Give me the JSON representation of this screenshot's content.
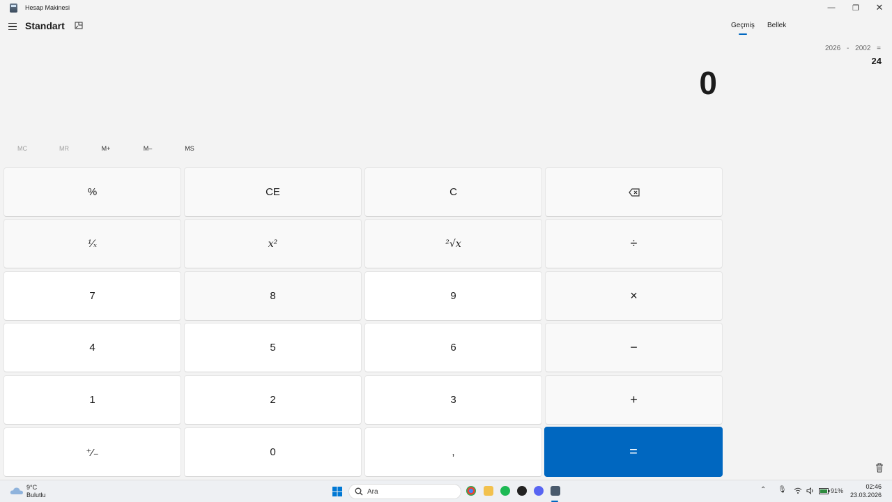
{
  "window": {
    "title": "Hesap Makinesi",
    "minimize": "—",
    "maximize": "❐",
    "close": "✕"
  },
  "header": {
    "mode_title": "Standart",
    "menu_icon": "hamburger-menu-icon",
    "keep_on_top_icon": "keep-on-top-icon"
  },
  "side_panel": {
    "tabs": [
      {
        "label": "Geçmiş",
        "active": true
      },
      {
        "label": "Bellek",
        "active": false
      }
    ],
    "history": {
      "expression": "2026 - 2002 =",
      "result": "24"
    },
    "trash_icon": "trash-icon"
  },
  "display": {
    "value": "0"
  },
  "memory": {
    "buttons": [
      {
        "label": "MC",
        "enabled": false
      },
      {
        "label": "MR",
        "enabled": false
      },
      {
        "label": "M+",
        "enabled": true
      },
      {
        "label": "M–",
        "enabled": true
      },
      {
        "label": "MS",
        "enabled": true
      }
    ]
  },
  "keypad": {
    "rows": [
      [
        "%",
        "CE",
        "C",
        "⌫"
      ],
      [
        "¹⁄ₓ",
        "x²",
        "²√x",
        "÷"
      ],
      [
        "7",
        "8",
        "9",
        "×"
      ],
      [
        "4",
        "5",
        "6",
        "−"
      ],
      [
        "1",
        "2",
        "3",
        "+"
      ],
      [
        "⁺⁄₋",
        "0",
        ",",
        "="
      ]
    ]
  },
  "taskbar": {
    "weather": {
      "temp": "9°C",
      "desc": "Bulutlu",
      "icon": "cloud-icon"
    },
    "search_placeholder": "Ara",
    "battery": "91%",
    "time": "02:46",
    "date": "23.03.2026"
  },
  "colors": {
    "accent": "#0067c0",
    "background": "#f3f3f3",
    "key_number": "#ffffff",
    "key_function": "#f9f9f9"
  }
}
